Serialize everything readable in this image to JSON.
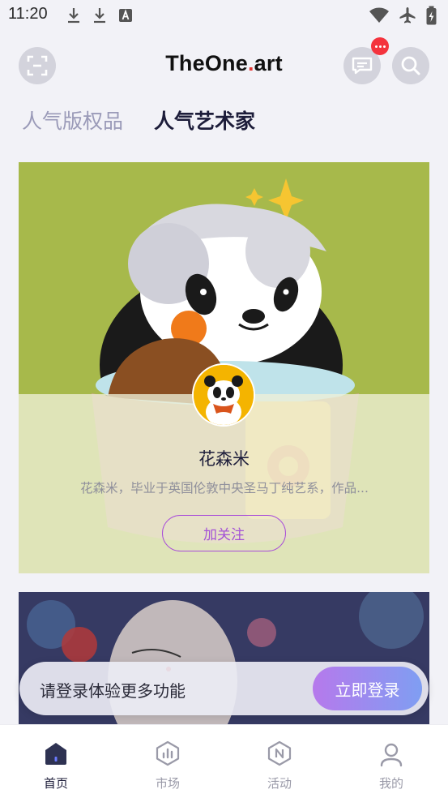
{
  "status_bar": {
    "time": "11:20",
    "icons_left": [
      "download-icon",
      "download-icon",
      "text-a-icon"
    ],
    "icons_right": [
      "wifi-icon",
      "airplane-icon",
      "battery-charging-icon"
    ]
  },
  "header": {
    "logo_prefix": "TheOne",
    "logo_dot": ".",
    "logo_suffix": "art",
    "left_icon": "scan-icon",
    "message_icon": "message-icon",
    "search_icon": "search-icon",
    "badge_color": "#f4333d"
  },
  "tabs": [
    {
      "label": "人气版权品",
      "active": false
    },
    {
      "label": "人气艺术家",
      "active": true
    }
  ],
  "artist_card": {
    "name": "花森米",
    "description": "花森米，毕业于英国伦敦中央圣马丁纯艺系，作品...",
    "follow_label": "加关注",
    "accent": "#a452d6"
  },
  "login_bar": {
    "prompt": "请登录体验更多功能",
    "button_label": "立即登录"
  },
  "bottom_nav": [
    {
      "label": "首页",
      "icon": "home-icon",
      "active": true
    },
    {
      "label": "市场",
      "icon": "market-chart-icon",
      "active": false
    },
    {
      "label": "活动",
      "icon": "activity-n-icon",
      "active": false
    },
    {
      "label": "我的",
      "icon": "profile-icon",
      "active": false
    }
  ]
}
